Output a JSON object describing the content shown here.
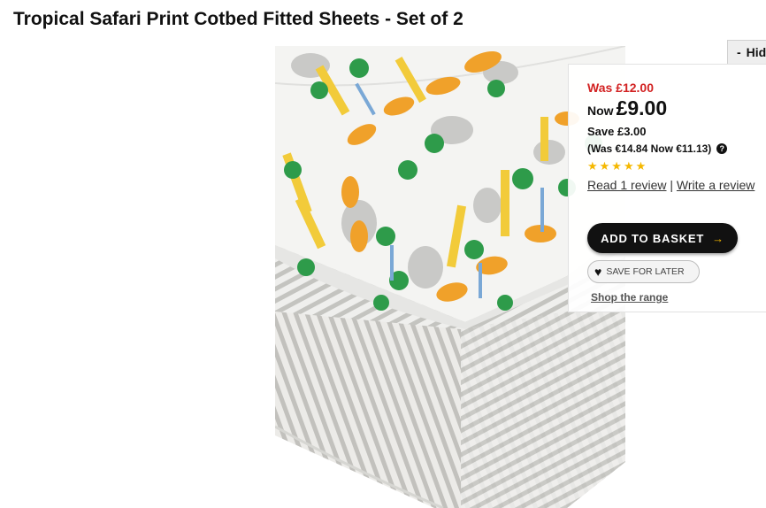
{
  "product": {
    "title": "Tropical Safari Print Cotbed Fitted Sheets - Set of 2"
  },
  "toggle": {
    "dash": "-",
    "label": "Hide"
  },
  "pricing": {
    "was": "Was £12.00",
    "now_label": "Now",
    "now_amount": "£9.00",
    "save": "Save £3.00",
    "euro": "(Was €14.84 Now €11.13)",
    "help_glyph": "?"
  },
  "rating": {
    "stars": "★★★★★",
    "value": 5,
    "out_of": 5,
    "read_link": "Read 1 review",
    "separator": "|",
    "write_link": "Write a review"
  },
  "actions": {
    "add_to_basket": "ADD TO BASKET",
    "basket_arrow": "→",
    "save_for_later": "SAVE FOR LATER",
    "heart": "♥",
    "shop_range": "Shop the range"
  },
  "colors": {
    "price_red": "#d22222",
    "star_yellow": "#f5b800",
    "button_black": "#111111"
  },
  "icons": [
    "help-icon",
    "heart-icon",
    "arrow-right-icon",
    "star-icon"
  ]
}
